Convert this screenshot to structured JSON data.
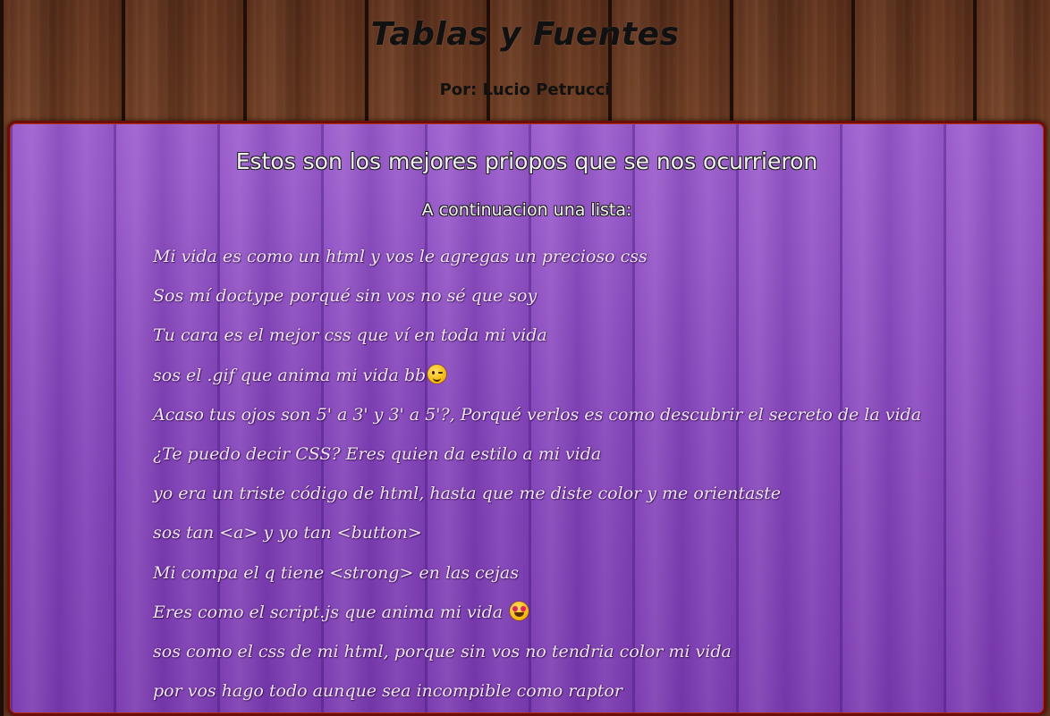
{
  "header": {
    "title": "Tablas y Fuentes",
    "author": "Por: Lucio Petrucci"
  },
  "main": {
    "heading": "Estos son los mejores priopos que se nos ocurrieron",
    "subheading": "A continuacion una lista:",
    "phrases": [
      "Mi vida es como un html y vos le agregas un precioso css",
      "Sos mí doctype porqué sin vos no sé que soy",
      "Tu cara es el mejor css que ví en toda mi vida",
      "sos el .gif que anima mi vida bb",
      "Acaso tus ojos son 5' a 3' y 3' a 5'?, Porqué verlos es como descubrir el secreto de la vida",
      "¿Te puedo decir CSS? Eres quien da estilo a mi vida",
      "yo era un triste código de html, hasta que me diste color y me orientaste",
      "sos tan <a> y yo tan <button>",
      "Mi compa el q tiene <strong> en las cejas",
      "Eres como el script.js que anima mi vida ",
      "sos como el css de mi html, porque sin vos no tendria color mi vida",
      "por vos hago todo aunque sea incompible como raptor"
    ],
    "emojis": {
      "phrase_4": "winking-face-icon",
      "phrase_10": "heart-eyes-face-icon"
    }
  },
  "colors": {
    "panel_border": "#6a0f0a",
    "panel_purple": "#8f4fc0",
    "wood": "#6b3a22"
  }
}
